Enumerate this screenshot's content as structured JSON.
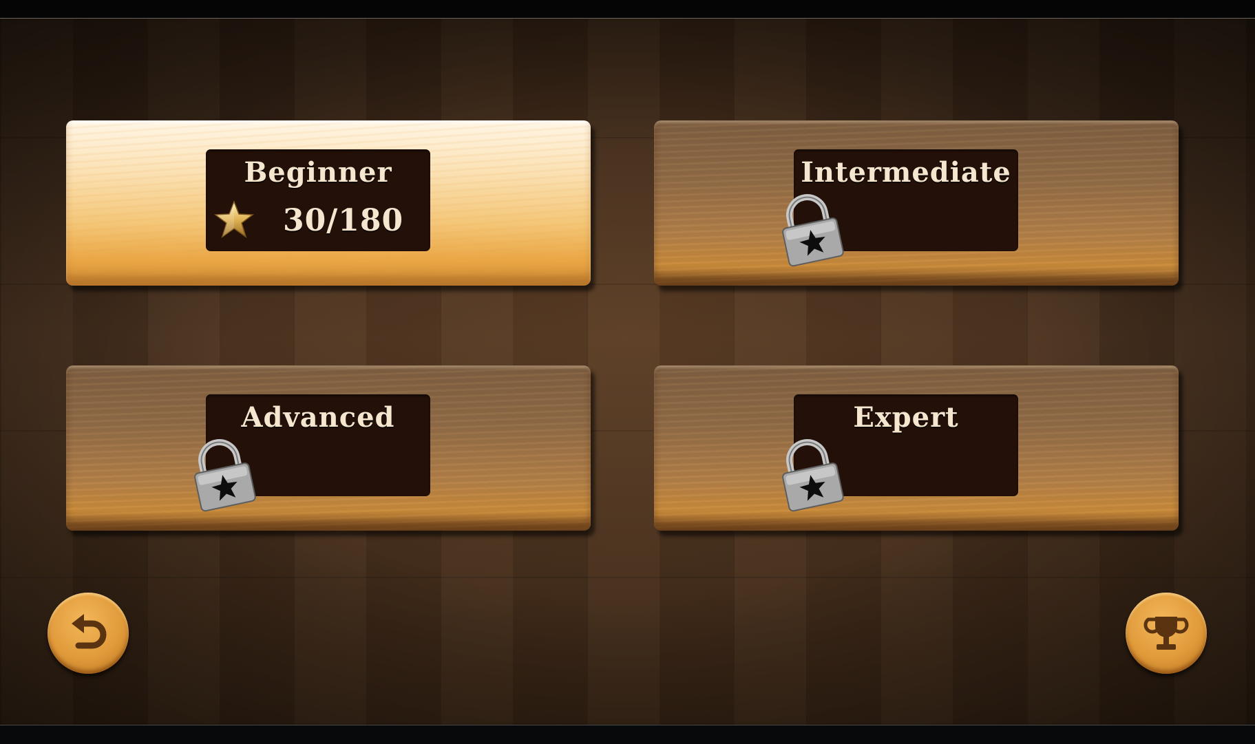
{
  "levels": [
    {
      "name": "Beginner",
      "state": "unlocked",
      "progress": "30/180"
    },
    {
      "name": "Intermediate",
      "state": "locked"
    },
    {
      "name": "Advanced",
      "state": "locked"
    },
    {
      "name": "Expert",
      "state": "locked"
    }
  ],
  "icons": {
    "progress": "star-icon",
    "locked": "padlock-star-icon",
    "back": "back-arrow-icon",
    "achievements": "trophy-icon"
  },
  "colors": {
    "plate": "#231109",
    "label_text": "#f4e6cf",
    "button_orange": "#e09a3a",
    "star_gold": "#d9a94a"
  }
}
